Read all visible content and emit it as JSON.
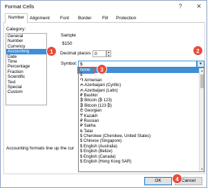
{
  "window": {
    "title": "Format Cells",
    "help": "?",
    "close": "✕"
  },
  "tabs": [
    "Number",
    "Alignment",
    "Font",
    "Border",
    "Fill",
    "Protection"
  ],
  "category": {
    "label": "Category:",
    "items": [
      "General",
      "Number",
      "Currency",
      "Accounting",
      "Date",
      "Time",
      "Percentage",
      "Fraction",
      "Scientific",
      "Text",
      "Special",
      "Custom"
    ],
    "selected": "Accounting"
  },
  "sample": {
    "label": "Sample",
    "value": "$150"
  },
  "decimal": {
    "label": "Decimal places:",
    "value": "0"
  },
  "symbol": {
    "label": "Symbol:",
    "value": "$",
    "options": [
      "None",
      "$",
      "֏ Armenian",
      "₼ Azerbaijani (Cyrillic)",
      "₼ Azerbaijani (Latin)",
      "₽ Bashkir",
      "₿ Bitcoin (₿ 123)",
      "₿ Bitcoin (123 ₿)",
      "₾ Georgian",
      "₸ Kazakh",
      "₽ Russian",
      "₽ Sakha",
      "₺ Tatar",
      "$ Cherokee (Cherokee, United States)",
      "$ Chinese (Singapore)",
      "$ English (Australia)",
      "$ English (Belize)",
      "$ English (Canada)",
      "$ English (Hong Kong SAR)"
    ],
    "highlighted": "None"
  },
  "description": "Accounting formats line up the cur",
  "buttons": {
    "ok": "OK",
    "cancel": "Cancel"
  },
  "markers": [
    "1",
    "2",
    "3",
    "4"
  ],
  "colors": {
    "accent": "#3c8fd9",
    "marker": "#e74c3c"
  }
}
